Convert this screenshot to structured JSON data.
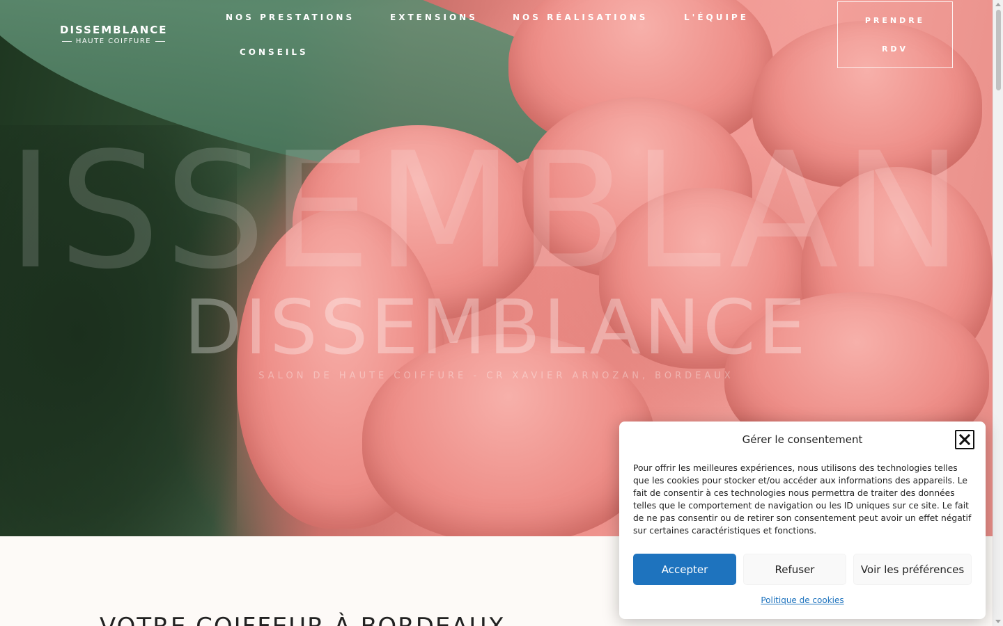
{
  "logo": {
    "main": "DISSEMBLANCE",
    "sub": "HAUTE COIFFURE"
  },
  "nav": {
    "items": [
      {
        "label": "NOS PRESTATIONS"
      },
      {
        "label": "EXTENSIONS"
      },
      {
        "label": "NOS RÉALISATIONS"
      },
      {
        "label": "L'ÉQUIPE"
      },
      {
        "label": "CONSEILS"
      }
    ],
    "cta": {
      "line1": "PRENDRE",
      "line2": "RDV"
    }
  },
  "hero": {
    "watermark": "ISSEMBLAN",
    "title": "DISSEMBLANCE",
    "subtitle": "SALON DE HAUTE COIFFURE - CR XAVIER ARNOZAN, BORDEAUX"
  },
  "section": {
    "heading": "VOTRE COIFFEUR À BORDEAUX"
  },
  "cookie": {
    "title": "Gérer le consentement",
    "text": "Pour offrir les meilleures expériences, nous utilisons des technologies telles que les cookies pour stocker et/ou accéder aux informations des appareils. Le fait de consentir à ces technologies nous permettra de traiter des données telles que le comportement de navigation ou les ID uniques sur ce site. Le fait de ne pas consentir ou de retirer son consentement peut avoir un effet négatif sur certaines caractéristiques et fonctions.",
    "accept": "Accepter",
    "refuse": "Refuser",
    "prefs": "Voir les préférences",
    "policy": "Politique de cookies",
    "accent_color": "#1e73be"
  }
}
